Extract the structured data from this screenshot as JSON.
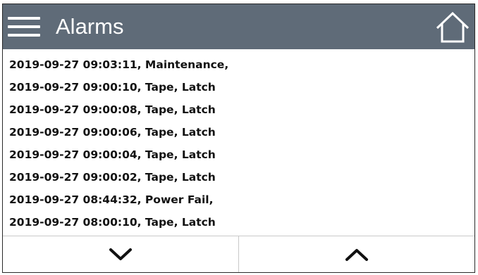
{
  "header": {
    "title": "Alarms",
    "background": "#5f6b78",
    "menu_icon": "hamburger-menu-icon",
    "home_icon": "home-icon"
  },
  "alarms": [
    "2019-09-27 09:03:11, Maintenance,",
    "2019-09-27 09:00:10, Tape, Latch",
    "2019-09-27 09:00:08, Tape, Latch",
    "2019-09-27 09:00:06, Tape, Latch",
    "2019-09-27 09:00:04, Tape, Latch",
    "2019-09-27 09:00:02, Tape, Latch",
    "2019-09-27 08:44:32, Power Fail,",
    "2019-09-27 08:00:10, Tape, Latch"
  ],
  "footer": {
    "down_icon": "chevron-down-icon",
    "up_icon": "chevron-up-icon"
  }
}
